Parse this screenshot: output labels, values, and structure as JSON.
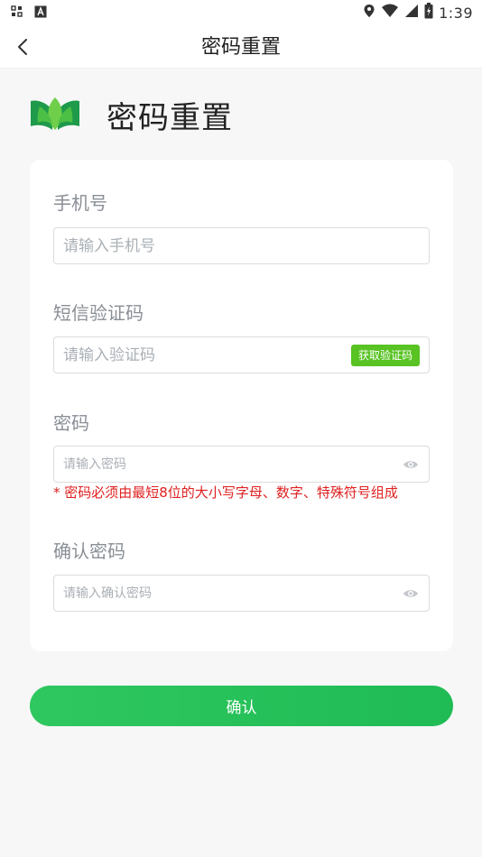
{
  "status_bar": {
    "time": "1:39",
    "left_icons": [
      "app-grid-icon",
      "text-a-icon"
    ],
    "right_icons": [
      "location-icon",
      "wifi-icon",
      "signal-icon",
      "battery-icon"
    ]
  },
  "nav": {
    "back_icon": "chevron-left-icon",
    "title": "密码重置"
  },
  "brand": {
    "logo_icon": "book-leaf-logo",
    "title": "密码重置"
  },
  "form": {
    "phone": {
      "label": "手机号",
      "placeholder": "请输入手机号",
      "value": ""
    },
    "sms": {
      "label": "短信验证码",
      "placeholder": "请输入验证码",
      "value": "",
      "get_code_label": "获取验证码"
    },
    "password": {
      "label": "密码",
      "placeholder": "请输入密码",
      "value": "",
      "hint": "* 密码必须由最短8位的大小写字母、数字、特殊符号组成"
    },
    "confirm_password": {
      "label": "确认密码",
      "placeholder": "请输入确认密码",
      "value": ""
    }
  },
  "confirm_button": "确认",
  "colors": {
    "primary_green": "#1fbb55",
    "code_button_green": "#58c322",
    "hint_red": "#e02020",
    "label_gray": "#8a8f96"
  }
}
